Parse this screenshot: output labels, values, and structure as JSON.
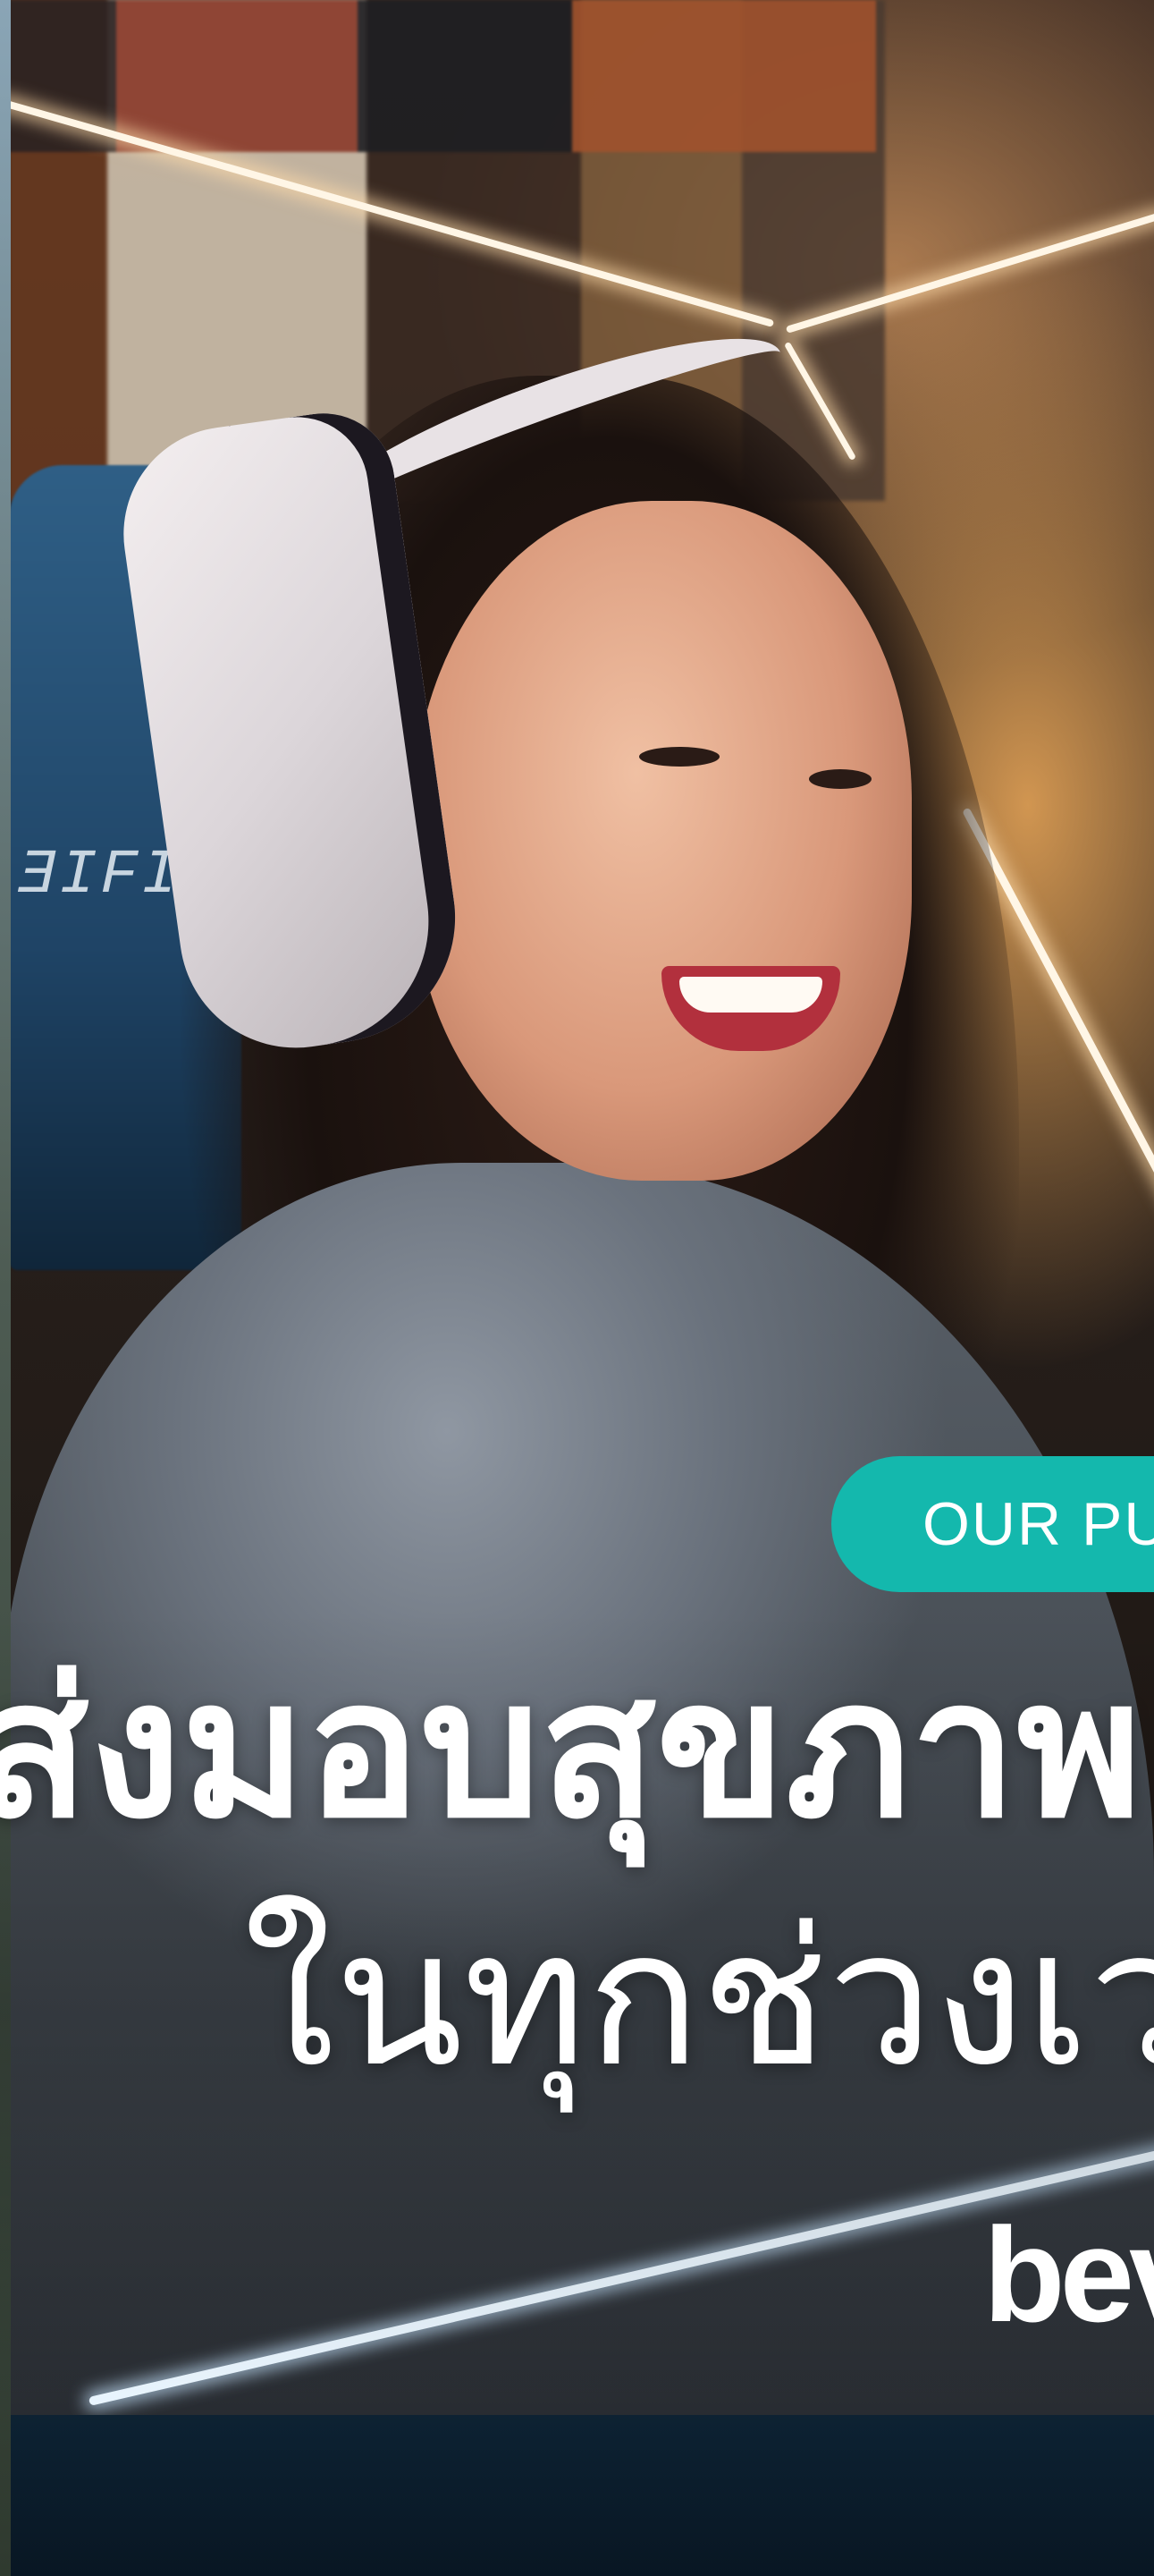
{
  "hero": {
    "badge_label": "OUR PU",
    "headline_line1": "ส่งมอบสุขภาพ",
    "headline_line2": "ในทุกช่วงเว",
    "brand_logo": "bev",
    "chair_mark": "ƎIFIB",
    "photo_subject": "smiling-gamer-with-headphones-photo"
  },
  "colors": {
    "accent": "#14b8ad",
    "text": "#ffffff",
    "neon": "#fff6e6"
  }
}
